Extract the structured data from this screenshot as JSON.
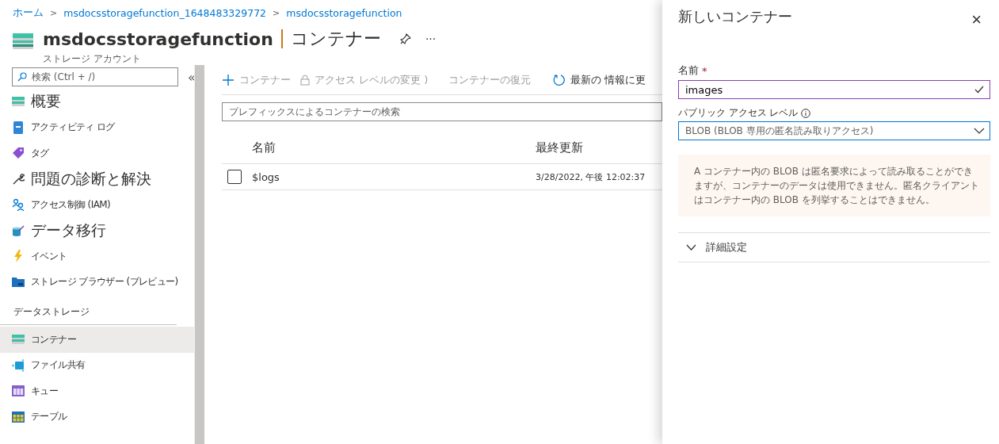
{
  "breadcrumb": {
    "items": [
      "ホーム",
      "msdocsstoragefunction_1648483329772",
      "msdocsstoragefunction"
    ],
    "separator": ">"
  },
  "header": {
    "resource": "msdocsstoragefunction",
    "page": "コンテナー",
    "subtitle": "ストレージ アカウント",
    "more": "···"
  },
  "sidebar": {
    "search": {
      "placeholder": "検索 (Ctrl + /)"
    },
    "collapse": "«",
    "items": [
      {
        "label": "概要",
        "kind": "storage",
        "large": true,
        "selected": false
      },
      {
        "label": "アクティビティ ログ",
        "kind": "log",
        "large": false,
        "selected": false
      },
      {
        "label": "タグ",
        "kind": "tag",
        "large": false,
        "selected": false
      },
      {
        "label": "問題の診断と解決",
        "kind": "wrench",
        "large": true,
        "selected": false
      },
      {
        "label": "アクセス制御 (IAM)",
        "kind": "people",
        "large": false,
        "selected": false
      },
      {
        "label": "データ移行",
        "kind": "migrate",
        "large": true,
        "selected": false
      },
      {
        "label": "イベント",
        "kind": "bolt",
        "large": false,
        "selected": false
      },
      {
        "label": "ストレージ ブラウザー (プレビュー)",
        "kind": "folder",
        "large": false,
        "selected": false
      }
    ],
    "section": "データストレージ",
    "section_items": [
      {
        "label": "コンテナー",
        "kind": "storage",
        "large": false,
        "selected": true
      },
      {
        "label": "ファイル共有",
        "kind": "share",
        "large": false,
        "selected": false
      },
      {
        "label": "キュー",
        "kind": "queue",
        "large": false,
        "selected": false
      },
      {
        "label": "テーブル",
        "kind": "table",
        "large": false,
        "selected": false
      }
    ]
  },
  "toolbar": {
    "add": "コンテナー",
    "access": "アクセス レベルの変更 )",
    "restore": "コンテナーの復元",
    "refresh": "最新の 情報に更"
  },
  "filter": {
    "placeholder": "プレフィックスによるコンテナーの検索"
  },
  "table": {
    "columns": [
      "名前",
      "最終更新"
    ],
    "rows": [
      {
        "name": "$logs",
        "modified": "3/28/2022, 午後 12:02:37",
        "checked": false
      }
    ]
  },
  "panel": {
    "title": "新しいコンテナー",
    "close": "×",
    "name_label": "名前",
    "required": "*",
    "name_value": "images",
    "access_label": "パブリック アクセス レベル",
    "access_value": "BLOB (BLOB 専用の匿名読み取りアクセス)",
    "info": "A コンテナー内の BLOB は匿名要求によって読み取ることができますが、コンテナーのデータは使用できません。匿名クライアントはコンテナー内の BLOB を列挙することはできません。",
    "advanced": {
      "label": "詳細設定",
      "expanded": false
    }
  }
}
